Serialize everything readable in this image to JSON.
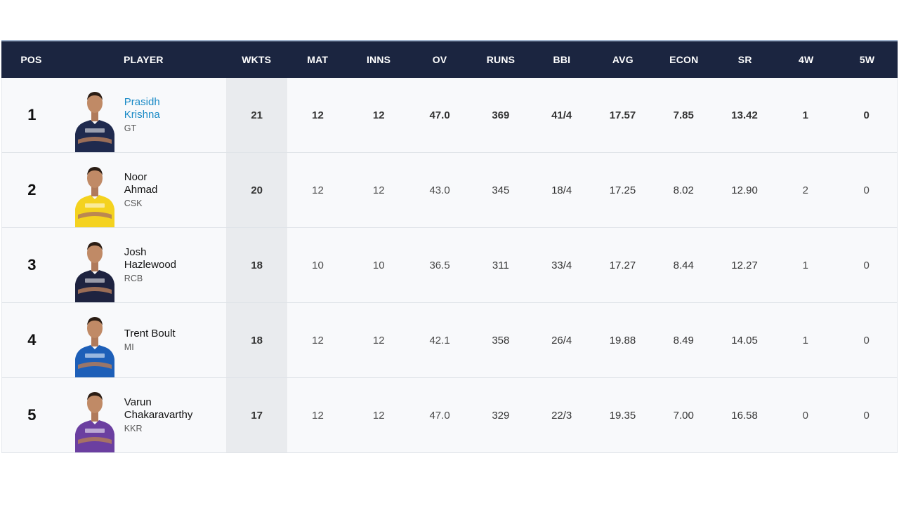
{
  "columns": {
    "pos": "POS",
    "player": "PLAYER",
    "wkts": "WKTS",
    "mat": "MAT",
    "inns": "INNS",
    "ov": "OV",
    "runs": "RUNS",
    "bbi": "BBI",
    "avg": "AVG",
    "econ": "ECON",
    "sr": "SR",
    "w4": "4W",
    "w5": "5W"
  },
  "colors": {
    "header_bg": "#1b2540",
    "highlight_link": "#1a8ac6",
    "wkts_column_bg": "#e9ebee"
  },
  "rows": [
    {
      "pos": "1",
      "name": "Prasidh\nKrishna",
      "team": "GT",
      "jersey_color": "#1f2a4e",
      "wkts": "21",
      "mat": "12",
      "inns": "12",
      "ov": "47.0",
      "runs": "369",
      "bbi": "41/4",
      "avg": "17.57",
      "econ": "7.85",
      "sr": "13.42",
      "w4": "1",
      "w5": "0"
    },
    {
      "pos": "2",
      "name": "Noor\nAhmad",
      "team": "CSK",
      "jersey_color": "#f4d21f",
      "wkts": "20",
      "mat": "12",
      "inns": "12",
      "ov": "43.0",
      "runs": "345",
      "bbi": "18/4",
      "avg": "17.25",
      "econ": "8.02",
      "sr": "12.90",
      "w4": "2",
      "w5": "0"
    },
    {
      "pos": "3",
      "name": "Josh\nHazlewood",
      "team": "RCB",
      "jersey_color": "#1e2340",
      "wkts": "18",
      "mat": "10",
      "inns": "10",
      "ov": "36.5",
      "runs": "311",
      "bbi": "33/4",
      "avg": "17.27",
      "econ": "8.44",
      "sr": "12.27",
      "w4": "1",
      "w5": "0"
    },
    {
      "pos": "4",
      "name": "Trent Boult",
      "team": "MI",
      "jersey_color": "#1d5fb8",
      "wkts": "18",
      "mat": "12",
      "inns": "12",
      "ov": "42.1",
      "runs": "358",
      "bbi": "26/4",
      "avg": "19.88",
      "econ": "8.49",
      "sr": "14.05",
      "w4": "1",
      "w5": "0"
    },
    {
      "pos": "5",
      "name": "Varun\nChakaravarthy",
      "team": "KKR",
      "jersey_color": "#6b3fa0",
      "wkts": "17",
      "mat": "12",
      "inns": "12",
      "ov": "47.0",
      "runs": "329",
      "bbi": "22/3",
      "avg": "19.35",
      "econ": "7.00",
      "sr": "16.58",
      "w4": "0",
      "w5": "0"
    }
  ]
}
